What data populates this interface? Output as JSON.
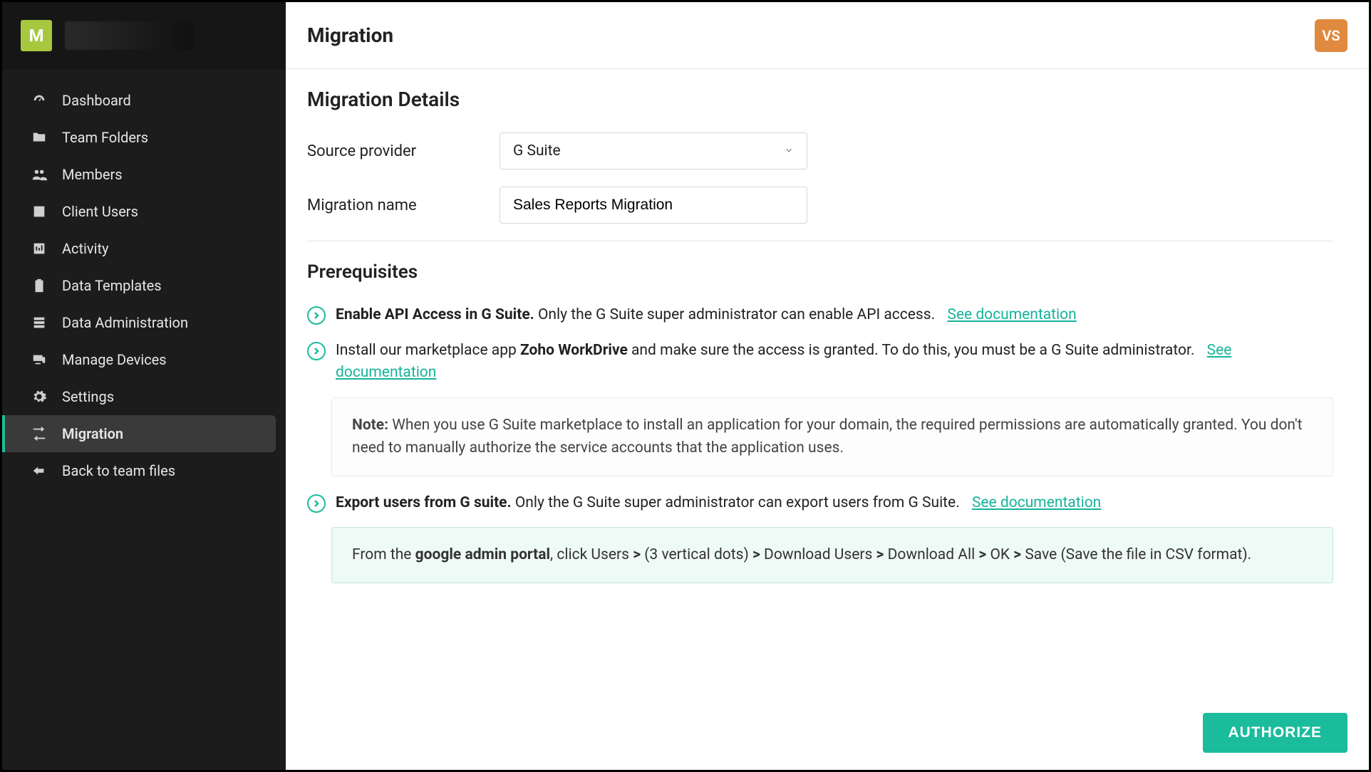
{
  "org": {
    "initial": "M"
  },
  "sidebar": {
    "items": [
      {
        "label": "Dashboard",
        "icon": "gauge-icon"
      },
      {
        "label": "Team Folders",
        "icon": "folder-icon"
      },
      {
        "label": "Members",
        "icon": "people-icon"
      },
      {
        "label": "Client Users",
        "icon": "user-card-icon"
      },
      {
        "label": "Activity",
        "icon": "chart-icon"
      },
      {
        "label": "Data Templates",
        "icon": "clipboard-icon"
      },
      {
        "label": "Data Administration",
        "icon": "admin-icon"
      },
      {
        "label": "Manage Devices",
        "icon": "devices-icon"
      },
      {
        "label": "Settings",
        "icon": "gear-icon"
      },
      {
        "label": "Migration",
        "icon": "migration-icon"
      },
      {
        "label": "Back to team files",
        "icon": "back-icon"
      }
    ],
    "active_index": 9
  },
  "header": {
    "title": "Migration",
    "avatar_initials": "VS"
  },
  "details": {
    "section_title": "Migration Details",
    "source_label": "Source provider",
    "source_value": "G Suite",
    "name_label": "Migration name",
    "name_value": "Sales Reports Migration"
  },
  "prereq": {
    "section_title": "Prerequisites",
    "items": [
      {
        "bold": "Enable API Access in G Suite.",
        "rest": " Only the G Suite super administrator can enable API access.",
        "link": "See documentation"
      },
      {
        "pre": "Install our marketplace app ",
        "bold": "Zoho WorkDrive",
        "rest": " and make sure the access is granted. To do this, you must be a G Suite administrator.",
        "link": "See documentation"
      },
      {
        "bold": "Export users from G suite.",
        "rest": " Only the G Suite super administrator can export users from G Suite.",
        "link": "See documentation"
      }
    ],
    "note": {
      "label": "Note:",
      "text": " When you use G Suite marketplace to install an application for your domain, the required permissions are automatically granted. You don't need to manually authorize the service accounts that the application uses."
    },
    "tip": {
      "pre": "From the ",
      "bold1": "google admin portal",
      "s1": ", click Users ",
      "gt1": ">",
      "s2": " (3 vertical dots) ",
      "gt2": ">",
      "s3": " Download Users ",
      "gt3": ">",
      "s4": " Download All ",
      "gt4": ">",
      "s5": " OK ",
      "gt5": ">",
      "s6": " Save (Save the file in CSV format)."
    }
  },
  "actions": {
    "authorize": "AUTHORIZE"
  }
}
